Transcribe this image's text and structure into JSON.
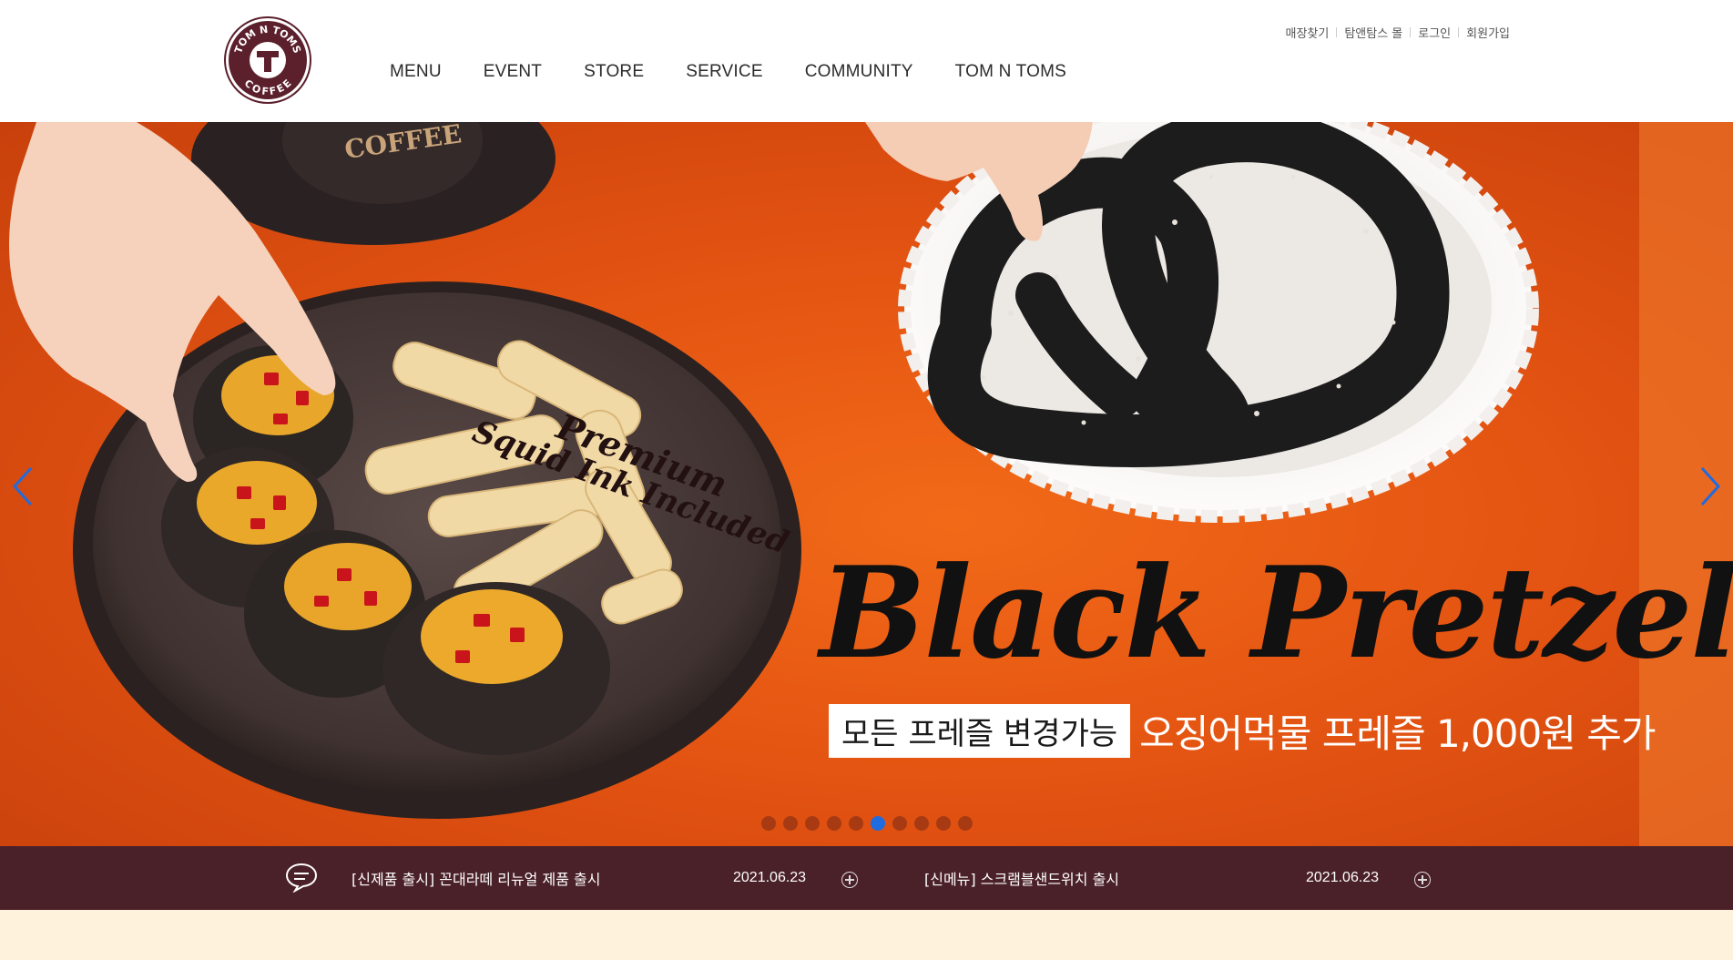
{
  "brand": {
    "logo_text_top": "TOM N TOMS",
    "logo_text_bottom": "COFFEE",
    "logo_icon": "t-cup-logo-icon"
  },
  "util_nav": [
    "매장찾기",
    "탐앤탐스 몰",
    "로그인",
    "회원가입"
  ],
  "gnb": [
    "MENU",
    "EVENT",
    "STORE",
    "SERVICE",
    "COMMUNITY",
    "TOM N TOMS"
  ],
  "hero": {
    "premium_line1": "Premium",
    "premium_line2": "Squid Ink Included",
    "headline": "Black Pretzel",
    "sub_box": "모든 프레즐 변경가능",
    "sub_text": "오징어먹물 프레즐 1,000원 추가",
    "cup_text": "COFFEE",
    "prev_icon": "chevron-left-icon",
    "next_icon": "chevron-right-icon",
    "slide_count": 10,
    "active_slide": 6
  },
  "notices": [
    {
      "title": "[신제품 출시] 꼰대라떼 리뉴얼 제품 출시",
      "date": "2021.06.23"
    },
    {
      "title": "[신메뉴] 스크램블샌드위치 출시",
      "date": "2021.06.23"
    }
  ],
  "colors": {
    "hero_orange": "#e45412",
    "notice_bar": "#4b2129",
    "logo_maroon": "#5c1f2c",
    "active_dot": "#1f6be0",
    "footer_band": "#fff2dc"
  }
}
